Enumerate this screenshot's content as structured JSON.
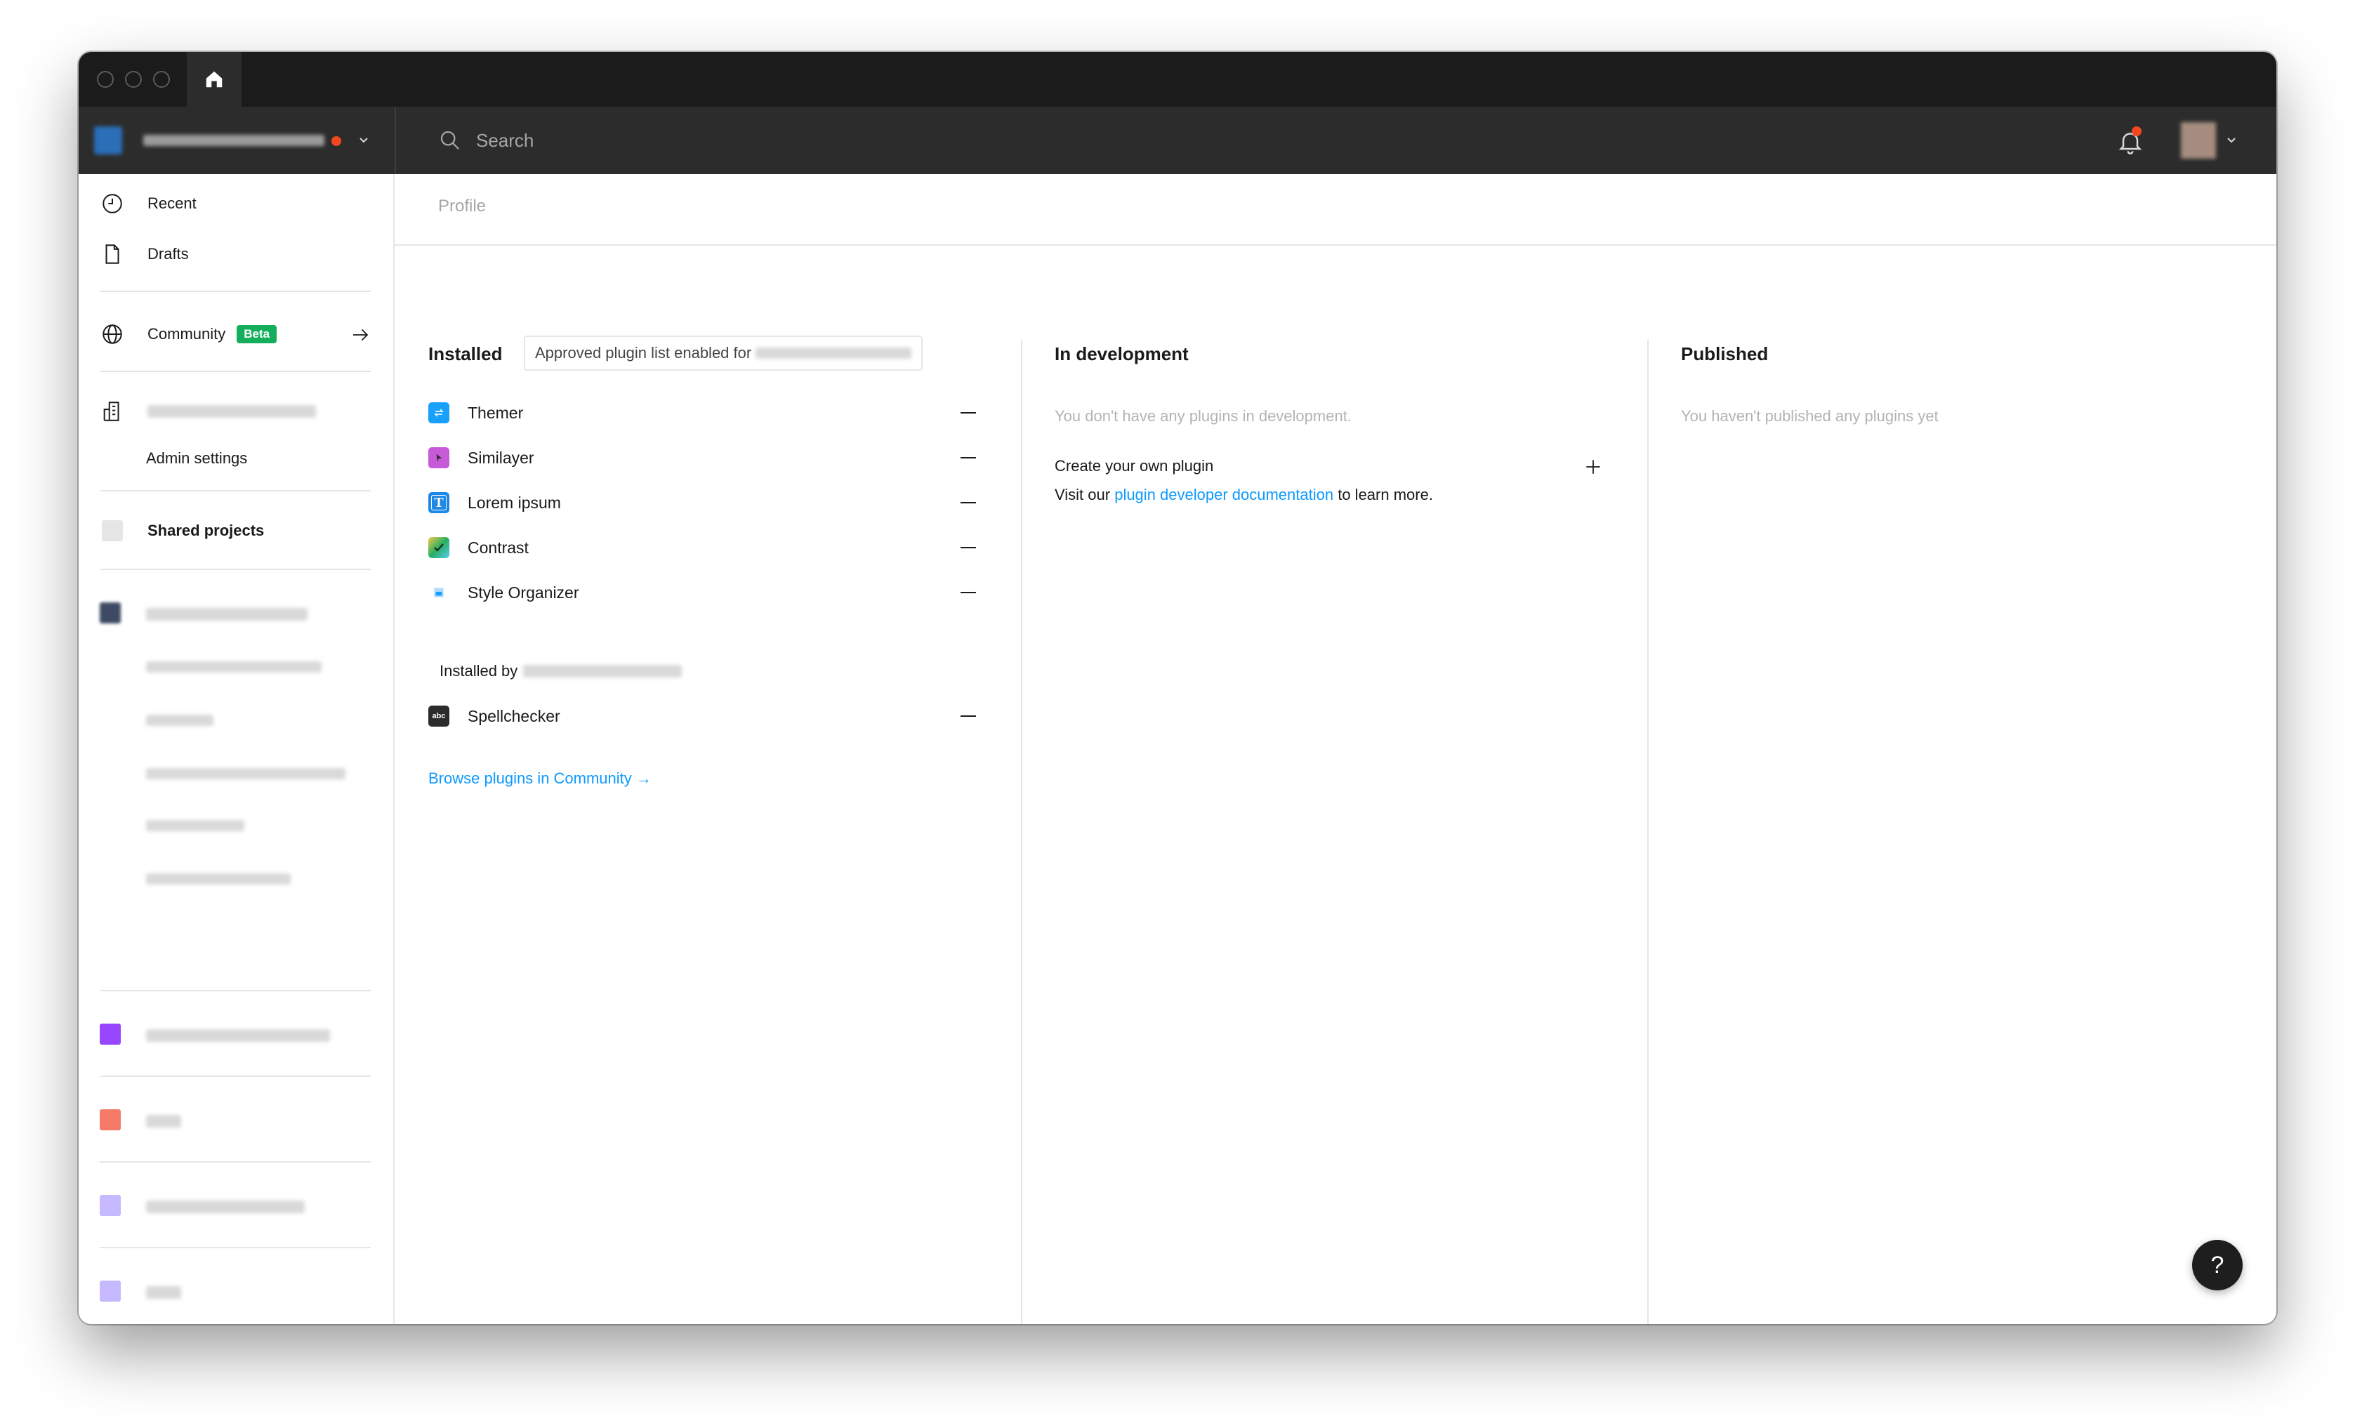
{
  "topbar": {
    "search_placeholder": "Search"
  },
  "sidebar": {
    "recent": "Recent",
    "drafts": "Drafts",
    "community": "Community",
    "community_badge": "Beta",
    "admin_settings": "Admin settings",
    "shared_projects": "Shared projects"
  },
  "page": {
    "tab": "Profile"
  },
  "installed": {
    "title": "Installed",
    "approved_label": "Approved plugin list enabled for",
    "plugins": [
      "Themer",
      "Similayer",
      "Lorem ipsum",
      "Contrast",
      "Style Organizer"
    ],
    "installed_by_label": "Installed by",
    "installed_by_plugins": [
      "Spellchecker"
    ],
    "spellchecker_icon_text": "abc",
    "lorem_icon_text": "T",
    "browse_link": "Browse plugins in Community →"
  },
  "in_development": {
    "title": "In development",
    "empty": "You don't have any plugins in development.",
    "create_label": "Create your own plugin",
    "visit_prefix": "Visit our",
    "docs_link": "plugin developer documentation",
    "visit_suffix": "to learn more."
  },
  "published": {
    "title": "Published",
    "empty": "You haven't published any plugins yet"
  },
  "help": {
    "label": "?"
  },
  "colors": {
    "accent": "#0d99ff",
    "beta": "#14ae5c",
    "notification": "#f24822",
    "project_purple": "#9747ff",
    "project_red": "#f24822",
    "project_lavender": "#c7b9ff"
  }
}
